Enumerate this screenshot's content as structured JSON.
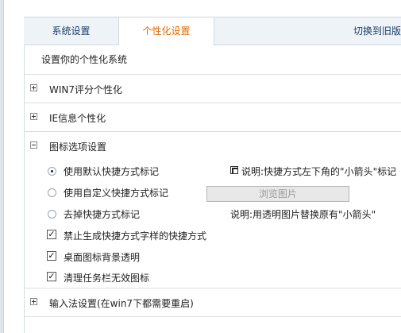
{
  "tabs": {
    "system": "系统设置",
    "personal": "个性化设置",
    "switch_old": "切换到旧版"
  },
  "subtitle": "设置你的个性化系统",
  "sections": {
    "win7": "WIN7评分个性化",
    "ie": "IE信息个性化",
    "icon_options": "图标选项设置",
    "ime": "输入法设置(在win7下都需要重启)"
  },
  "shortcut_options": {
    "default": "使用默认快捷方式标记",
    "custom": "使用自定义快捷方式标记",
    "remove": "去掉快捷方式标记",
    "selected": "default"
  },
  "checkboxes": {
    "no_shortcut_suffix": "禁止生成快捷方式字样的快捷方式",
    "desktop_transparent": "桌面图标背景透明",
    "clean_tray": "清理任务栏无效图标"
  },
  "right_panel": {
    "note_top": "说明:快捷方式左下角的\"小箭头\"标记",
    "browse": "浏览图片",
    "note_bottom": "说明:用透明图片替换原有\"小箭头\""
  }
}
